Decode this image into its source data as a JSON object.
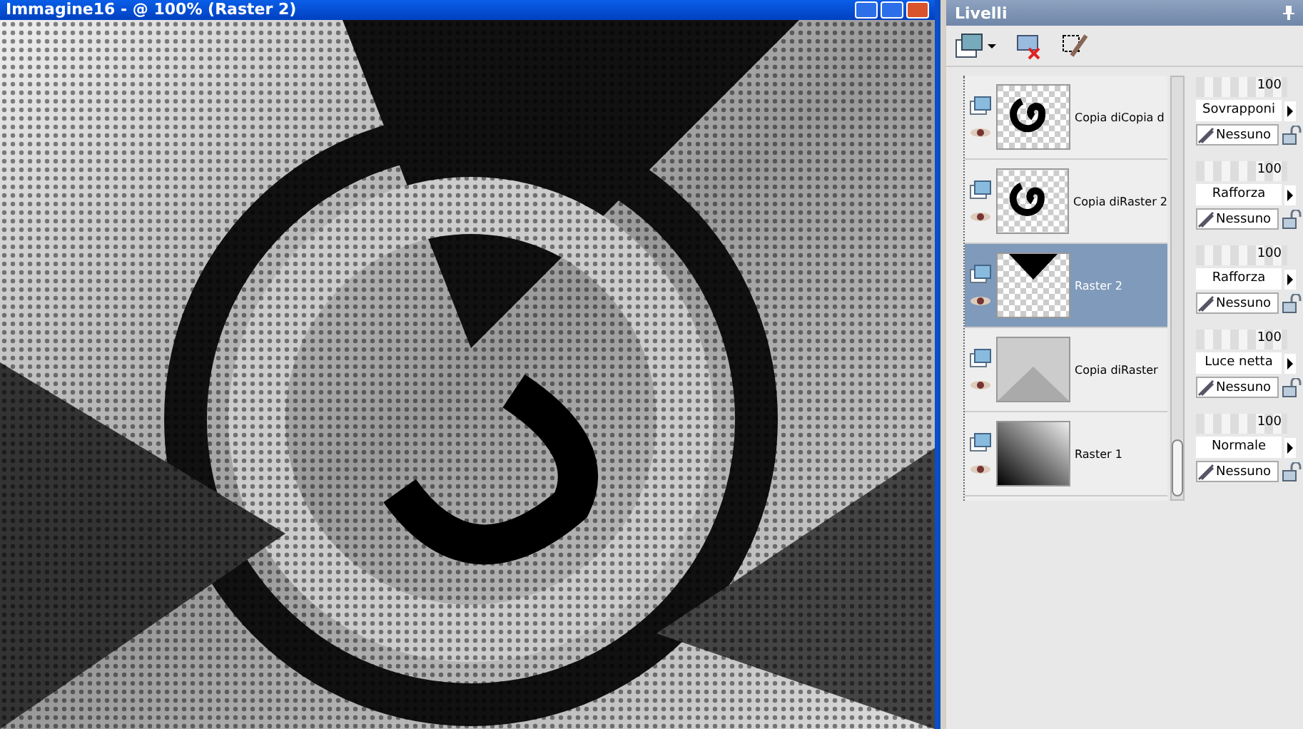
{
  "document_window": {
    "title": "Immagine16 - @ 100% (Raster 2)"
  },
  "layers_panel": {
    "title": "Livelli",
    "layers": [
      {
        "name": "Copia diCopia d",
        "kind": "swirl",
        "selected": false,
        "level": 1,
        "opacity": "100",
        "blend_mode": "Sovrapponi",
        "mask": "Nessuno"
      },
      {
        "name": "Copia diRaster 2",
        "kind": "swirl",
        "selected": false,
        "level": 1,
        "opacity": "100",
        "blend_mode": "Rafforza",
        "mask": "Nessuno"
      },
      {
        "name": "Raster 2",
        "kind": "triangle",
        "selected": true,
        "level": 1,
        "opacity": "100",
        "blend_mode": "Rafforza",
        "mask": "Nessuno"
      },
      {
        "name": "Copia diRaster",
        "kind": "pattern",
        "selected": false,
        "level": 1,
        "opacity": "100",
        "blend_mode": "Luce netta",
        "mask": "Nessuno"
      },
      {
        "name": "Raster 1",
        "kind": "gradient",
        "selected": false,
        "level": 1,
        "opacity": "100",
        "blend_mode": "Normale",
        "mask": "Nessuno"
      }
    ]
  }
}
